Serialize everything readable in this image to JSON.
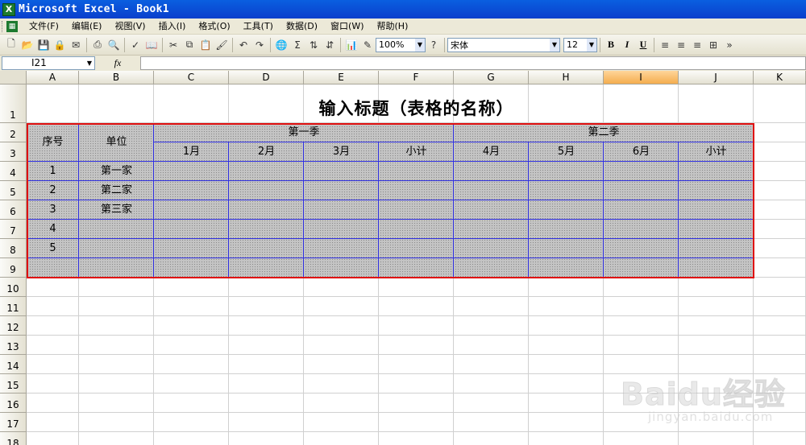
{
  "window": {
    "app_icon": "excel-icon",
    "title": "Microsoft Excel - Book1"
  },
  "menu": [
    "文件(F)",
    "编辑(E)",
    "视图(V)",
    "插入(I)",
    "格式(O)",
    "工具(T)",
    "数据(D)",
    "窗口(W)",
    "帮助(H)"
  ],
  "toolbar": {
    "zoom": "100%",
    "font_name": "宋体",
    "font_size": "12",
    "bold": "B",
    "italic": "I",
    "underline": "U",
    "sum": "Σ"
  },
  "formula_bar": {
    "name_box": "I21",
    "fx": "fx",
    "content": ""
  },
  "columns": [
    "A",
    "B",
    "C",
    "D",
    "E",
    "F",
    "G",
    "H",
    "I",
    "J",
    "K"
  ],
  "selected_column": "I",
  "rows": [
    "1",
    "2",
    "3",
    "4",
    "5",
    "6",
    "7",
    "8",
    "9",
    "10",
    "11",
    "12",
    "13",
    "14",
    "15",
    "16",
    "17",
    "18"
  ],
  "sheet": {
    "title": "输入标题（表格的名称）",
    "header": {
      "seq": "序号",
      "unit": "单位",
      "q1": "第一季",
      "q2": "第二季",
      "months": [
        "1月",
        "2月",
        "3月",
        "小计",
        "4月",
        "5月",
        "6月",
        "小计"
      ]
    },
    "rows": [
      {
        "seq": "1",
        "unit": "第一家"
      },
      {
        "seq": "2",
        "unit": "第二家"
      },
      {
        "seq": "3",
        "unit": "第三家"
      },
      {
        "seq": "4",
        "unit": ""
      },
      {
        "seq": "5",
        "unit": ""
      },
      {
        "seq": "",
        "unit": ""
      }
    ]
  },
  "watermark": {
    "brand": "Baidu经验",
    "url": "jingyan.baidu.com"
  }
}
